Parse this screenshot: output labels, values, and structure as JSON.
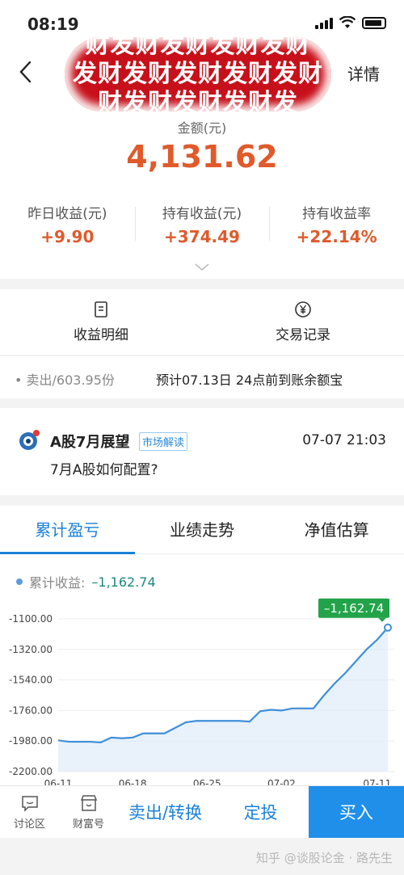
{
  "status": {
    "time": "08:19"
  },
  "header": {
    "banner_lines": [
      "财发财发财发财发财",
      "发财发财发财发财发财",
      "财发财发财发财发"
    ],
    "detail_label": "详情",
    "amount_label": "金额(元)",
    "amount": "4,131.62",
    "stats": [
      {
        "label": "昨日收益(元)",
        "value": "+9.90"
      },
      {
        "label": "持有收益(元)",
        "value": "+374.49"
      },
      {
        "label": "持有收益率",
        "value": "+22.14%"
      }
    ]
  },
  "actions": {
    "income_detail": "收益明细",
    "trade_record": "交易记录"
  },
  "notice": {
    "left": "• 卖出/603.95份",
    "right": "预计07.13日 24点前到账余额宝"
  },
  "news": {
    "title": "A股7月展望",
    "tag": "市场解读",
    "time": "07-07 21:03",
    "subtitle": "7月A股如何配置?"
  },
  "tabs": [
    "累计盈亏",
    "业绩走势",
    "净值估算"
  ],
  "legend": {
    "label": "累计收益:",
    "value": "–1,162.74"
  },
  "chart_data": {
    "type": "line",
    "x": [
      "06-11",
      "06-12",
      "06-13",
      "06-14",
      "06-15",
      "06-16",
      "06-17",
      "06-18",
      "06-19",
      "06-20",
      "06-21",
      "06-22",
      "06-23",
      "06-24",
      "06-25",
      "06-26",
      "06-27",
      "06-28",
      "06-29",
      "06-30",
      "07-01",
      "07-02",
      "07-03",
      "07-04",
      "07-05",
      "07-06",
      "07-07",
      "07-08",
      "07-09",
      "07-10",
      "07-11",
      "07-12"
    ],
    "xtick_labels": [
      "06-11",
      "06-18",
      "06-25",
      "07-02",
      "07-11"
    ],
    "xtick_index": [
      0,
      7,
      14,
      21,
      30
    ],
    "values": [
      -1975,
      -1985,
      -1985,
      -1985,
      -1990,
      -1955,
      -1960,
      -1955,
      -1925,
      -1925,
      -1925,
      -1885,
      -1845,
      -1835,
      -1835,
      -1835,
      -1835,
      -1835,
      -1840,
      -1765,
      -1755,
      -1760,
      -1745,
      -1745,
      -1745,
      -1650,
      -1565,
      -1490,
      -1405,
      -1320,
      -1250,
      -1162.74
    ],
    "yticks": [
      "-1100.00",
      "-1320.00",
      "-1540.00",
      "-1760.00",
      "-1980.00",
      "-2200.00"
    ],
    "ylim": [
      -2200,
      -1100
    ],
    "last_label": "–1,162.74",
    "colors": {
      "line": "#3f8fd8",
      "fill": "#dbeaf8",
      "label_bg": "#22a34a"
    }
  },
  "bottombar": {
    "forum": "讨论区",
    "fortune": "财富号",
    "sell": "卖出/转换",
    "fixed": "定投",
    "buy": "买入"
  },
  "watermark": "知乎 @谈股论金 · 路先生"
}
